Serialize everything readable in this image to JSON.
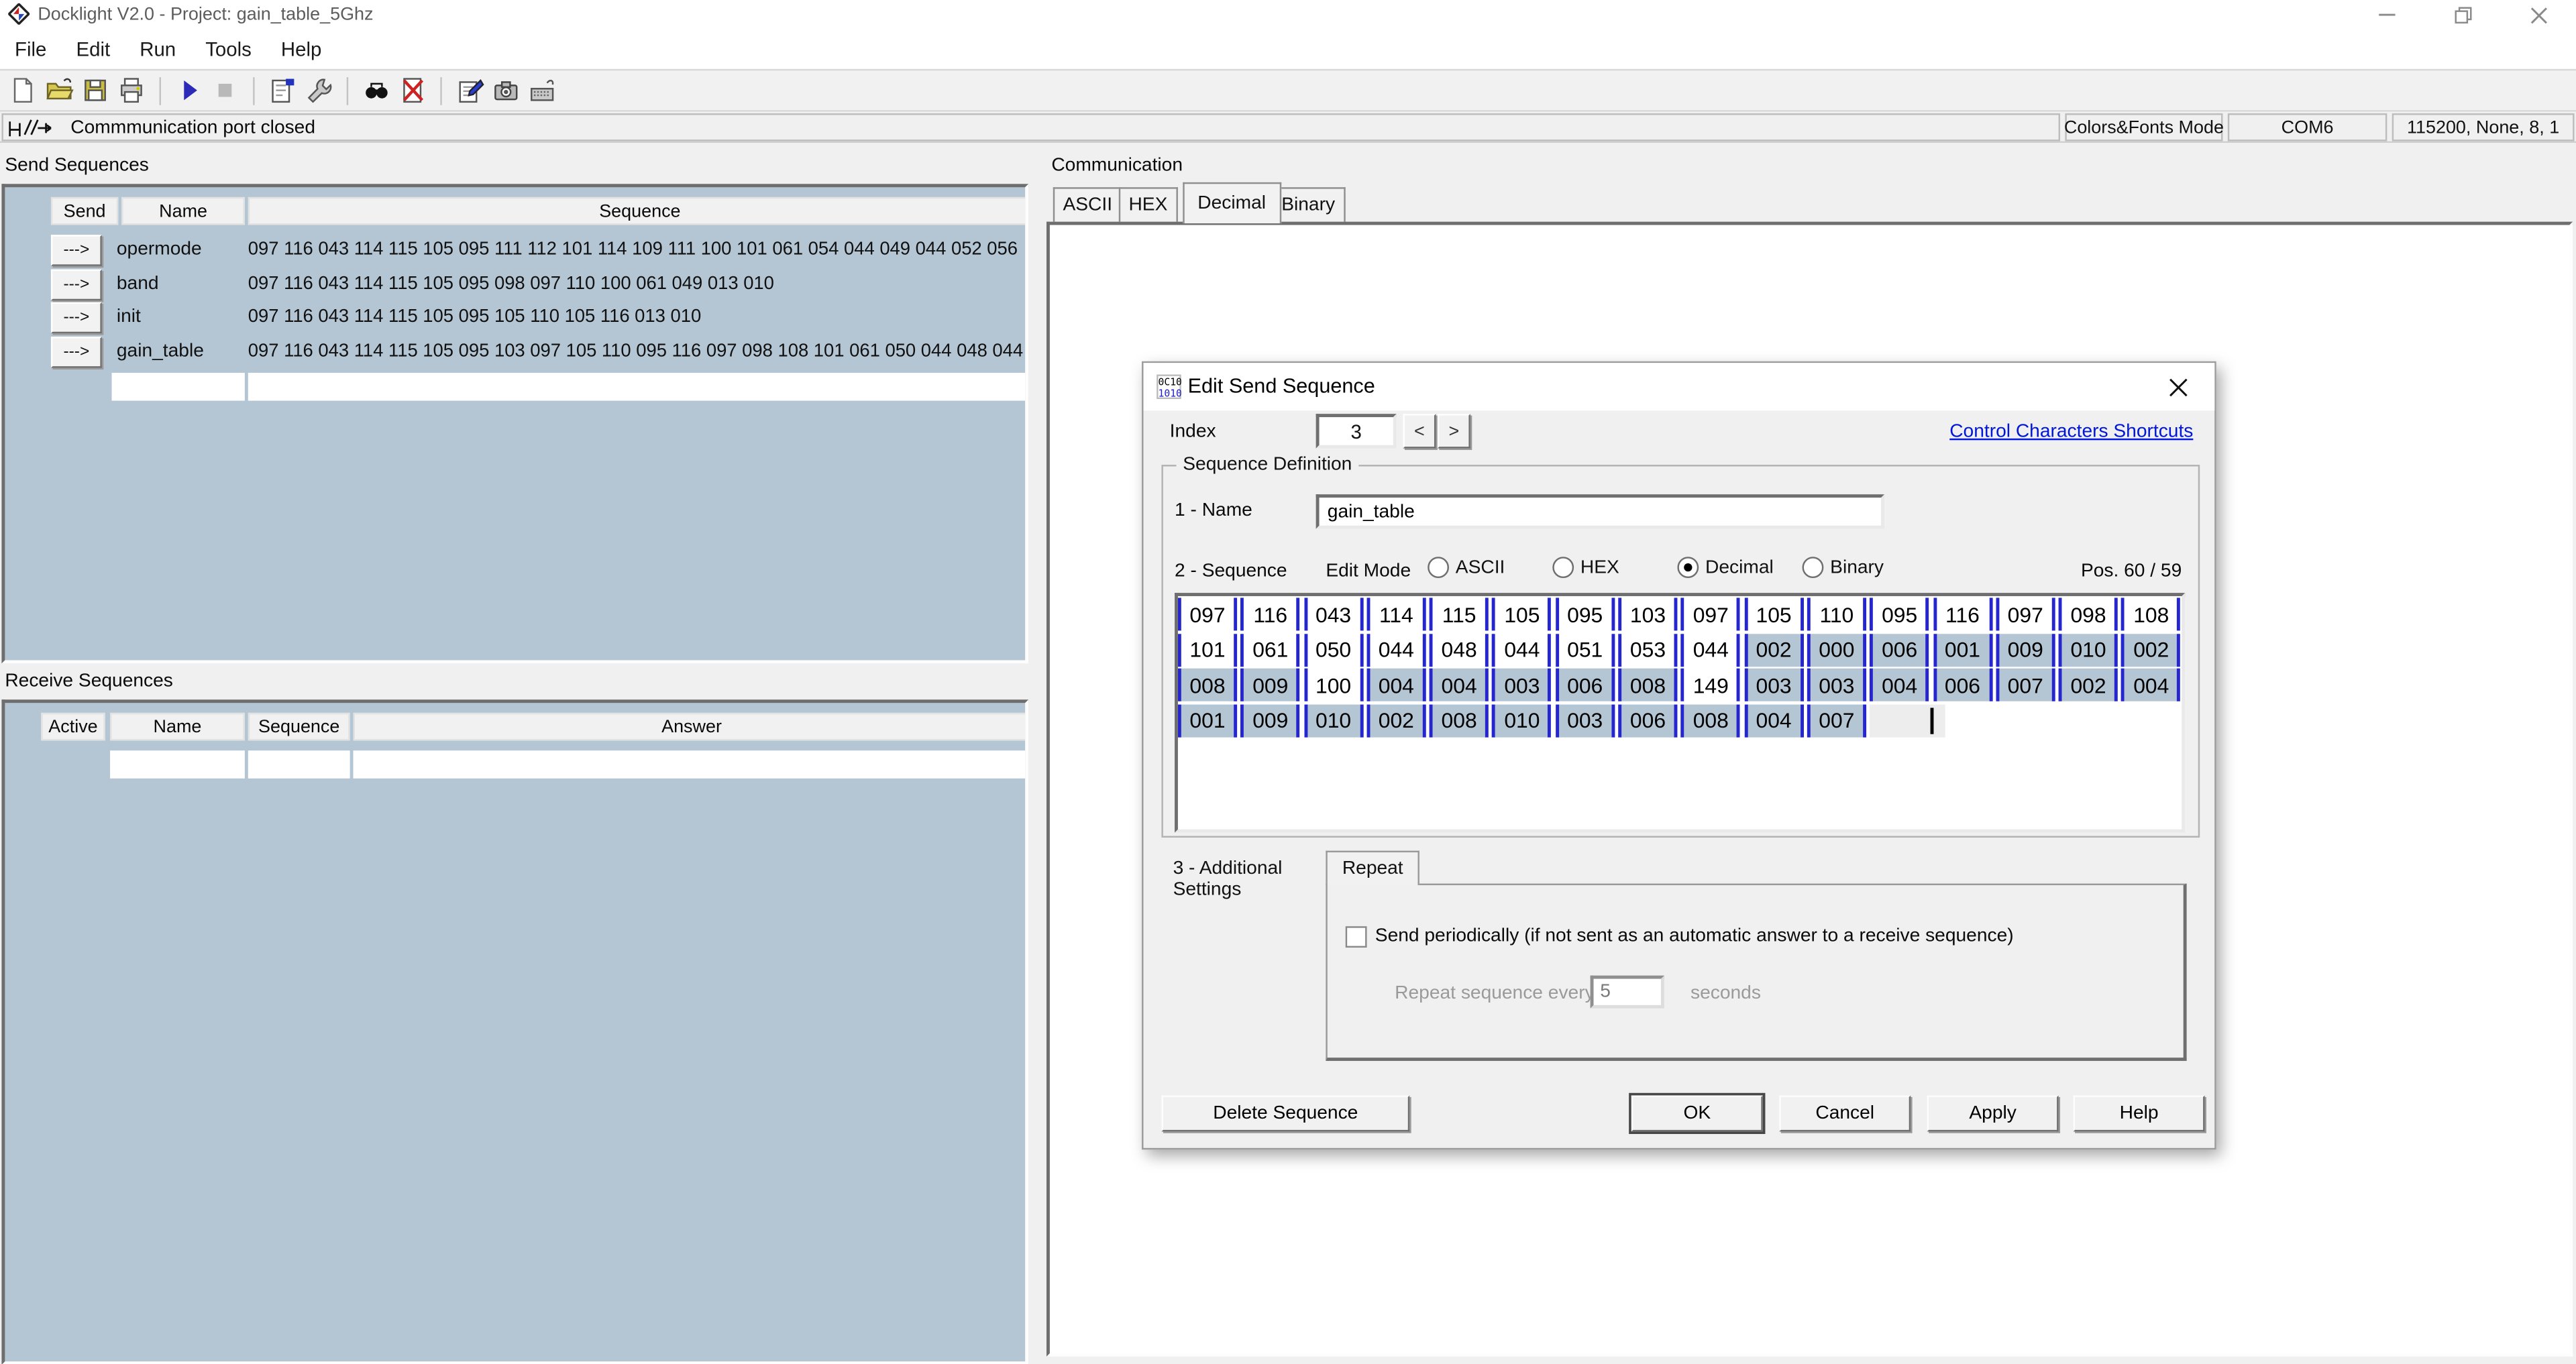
{
  "window": {
    "title": "Docklight V2.0 - Project: gain_table_5Ghz"
  },
  "menu": {
    "items": [
      "File",
      "Edit",
      "Run",
      "Tools",
      "Help"
    ]
  },
  "statusbar": {
    "message": "Commmunication port closed",
    "mode": "Colors&Fonts Mode",
    "port": "COM6",
    "params": "115200, None, 8, 1"
  },
  "send_sequences": {
    "title": "Send Sequences",
    "columns": [
      "Send",
      "Name",
      "Sequence"
    ],
    "send_button": "--->",
    "rows": [
      {
        "name": "opermode",
        "sequence": "097 116 043 114 115 105 095 111 112 101 114 109 111 100 101 061 054 044 049 044 052 056"
      },
      {
        "name": "band",
        "sequence": "097 116 043 114 115 105 095 098 097 110 100 061 049 013 010"
      },
      {
        "name": "init",
        "sequence": "097 116 043 114 115 105 095 105 110 105 116 013 010"
      },
      {
        "name": "gain_table",
        "sequence": "097 116 043 114 115 105 095 103 097 105 110 095 116 097 098 108 101 061 050 044 048 044"
      }
    ]
  },
  "receive_sequences": {
    "title": "Receive Sequences",
    "columns": [
      "Active",
      "Name",
      "Sequence",
      "Answer"
    ]
  },
  "communication": {
    "title": "Communication",
    "tabs": [
      "ASCII",
      "HEX",
      "Decimal",
      "Binary"
    ],
    "active_tab": "Decimal"
  },
  "dialog": {
    "title": "Edit Send Sequence",
    "index_label": "Index",
    "index_value": "3",
    "prev_label": "<",
    "next_label": ">",
    "shortcuts_link": "Control Characters Shortcuts",
    "group_title": "Sequence Definition",
    "name_label": "1 - Name",
    "name_value": "gain_table",
    "sequence_label": "2 - Sequence",
    "edit_mode_label": "Edit Mode",
    "edit_modes": [
      {
        "label": "ASCII",
        "selected": false
      },
      {
        "label": "HEX",
        "selected": false
      },
      {
        "label": "Decimal",
        "selected": true
      },
      {
        "label": "Binary",
        "selected": false
      }
    ],
    "pos_label": "Pos. 60 / 59",
    "grid_rows": [
      {
        "values": [
          "097",
          "116",
          "043",
          "114",
          "115",
          "105",
          "095",
          "103",
          "097",
          "105",
          "110",
          "095",
          "116",
          "097",
          "098",
          "108"
        ],
        "selected": [
          false,
          false,
          false,
          false,
          false,
          false,
          false,
          false,
          false,
          false,
          false,
          false,
          false,
          false,
          false,
          false
        ]
      },
      {
        "values": [
          "101",
          "061",
          "050",
          "044",
          "048",
          "044",
          "051",
          "053",
          "044",
          "002",
          "000",
          "006",
          "001",
          "009",
          "010",
          "002"
        ],
        "selected": [
          false,
          false,
          false,
          false,
          false,
          false,
          false,
          false,
          false,
          true,
          true,
          true,
          true,
          true,
          true,
          true
        ]
      },
      {
        "values": [
          "008",
          "009",
          "100",
          "004",
          "004",
          "003",
          "006",
          "008",
          "149",
          "003",
          "003",
          "004",
          "006",
          "007",
          "002",
          "004"
        ],
        "selected": [
          true,
          true,
          false,
          true,
          true,
          true,
          true,
          true,
          false,
          true,
          true,
          true,
          true,
          true,
          true,
          true
        ]
      },
      {
        "values": [
          "001",
          "009",
          "010",
          "002",
          "008",
          "010",
          "003",
          "006",
          "008",
          "004",
          "007"
        ],
        "selected": [
          true,
          true,
          true,
          true,
          true,
          true,
          true,
          true,
          true,
          true,
          true
        ]
      }
    ],
    "additional_label": "3 - Additional Settings",
    "repeat_tab": "Repeat",
    "send_periodically_label": "Send periodically  (if not sent as an automatic answer to a receive sequence)",
    "repeat_every_label": "Repeat sequence every",
    "repeat_value": "5",
    "seconds_label": "seconds",
    "buttons": {
      "delete": "Delete Sequence",
      "ok": "OK",
      "cancel": "Cancel",
      "apply": "Apply",
      "help": "Help"
    }
  }
}
